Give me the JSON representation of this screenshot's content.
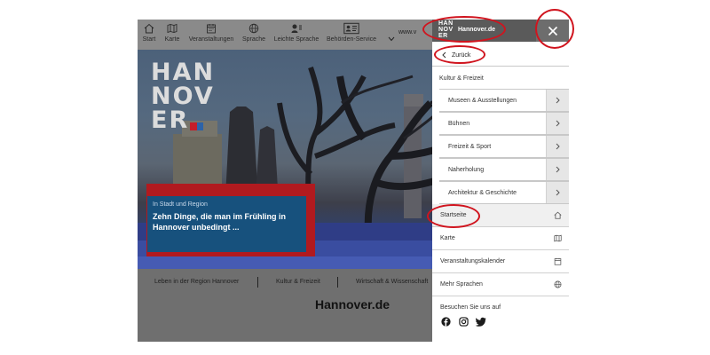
{
  "topnav": {
    "items": [
      {
        "label": "Start",
        "icon": "home-icon"
      },
      {
        "label": "Karte",
        "icon": "map-icon"
      },
      {
        "label": "Veranstaltungen",
        "icon": "calendar-icon"
      },
      {
        "label": "Sprache",
        "icon": "globe-icon"
      },
      {
        "label": "Leichte Sprache",
        "icon": "easy-language-icon"
      },
      {
        "label": "Behörden-Service",
        "icon": "id-card-icon"
      }
    ],
    "url_fragment": "www.v"
  },
  "hero": {
    "logo_lines": [
      "HAN",
      "NOV",
      "ER"
    ],
    "kicker": "In Stadt und Region",
    "headline": "Zehn Dinge, die man im Frühling in Hannover unbedingt ..."
  },
  "band": {
    "links": [
      "Leben in der Region Hannover",
      "Kultur & Freizeit",
      "Wirtschaft & Wissenschaft"
    ],
    "title": "Hannover.de"
  },
  "panel": {
    "logo_lines": [
      "HAN",
      "NOV",
      "ER"
    ],
    "site_name": "Hannover.de",
    "back_label": "Zurück",
    "section_title": "Kultur & Freizeit",
    "subitems": [
      "Museen & Ausstellungen",
      "Bühnen",
      "Freizeit & Sport",
      "Naherholung",
      "Architektur & Geschichte"
    ],
    "main_items": [
      {
        "label": "Startseite",
        "icon": "home-icon"
      },
      {
        "label": "Karte",
        "icon": "map-icon"
      },
      {
        "label": "Veranstaltungskalender",
        "icon": "calendar-icon"
      },
      {
        "label": "Mehr Sprachen",
        "icon": "globe-icon"
      }
    ],
    "social_title": "Besuchen Sie uns auf",
    "social": [
      "facebook-icon",
      "instagram-icon",
      "twitter-icon"
    ]
  },
  "colors": {
    "annotation": "#d0141e",
    "panel_header": "#5a5a5a",
    "hero_card": "#17517d",
    "hero_card_accent": "#b11a1f"
  }
}
